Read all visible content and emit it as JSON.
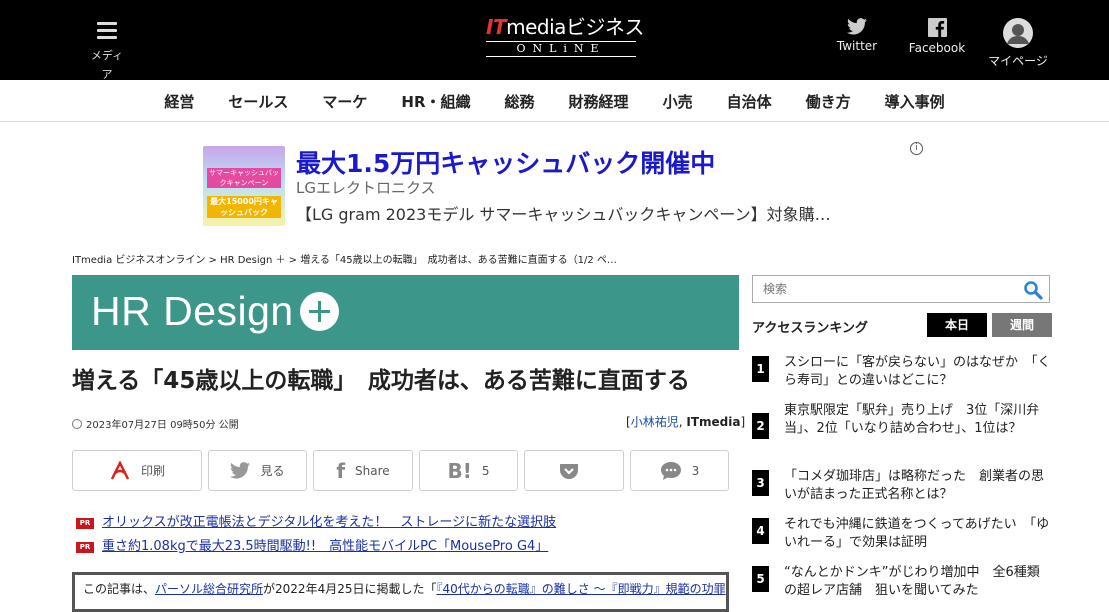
{
  "header": {
    "menu_label": "メディア",
    "logo_part1": "IT",
    "logo_part2": "media",
    "logo_part3": "ビジネス",
    "logo_sub": "ONLiNE",
    "twitter_label": "Twitter",
    "facebook_label": "Facebook",
    "mypage_label": "マイページ"
  },
  "nav": {
    "items": [
      "経営",
      "セールス",
      "マーケ",
      "HR・組織",
      "総務",
      "財務経理",
      "小売",
      "自治体",
      "働き方",
      "導入事例"
    ]
  },
  "ad": {
    "image_text1": "サマーキャッシュバックキャンペーン",
    "image_text2": "最大15000円キャッシュバック",
    "title": "最大1.5万円キャッシュバック開催中",
    "sponsor": "LGエレクトロニクス",
    "description": "【LG gram 2023モデル サマーキャッシュバックキャンペーン】対象購…",
    "info_icon": "i"
  },
  "breadcrumb": "ITmedia ビジネスオンライン > HR Design ＋ > 増える「45歳以上の転職」　成功者は、ある苦難に直面する（1/2 ペ…",
  "banner": {
    "title": "HR Design"
  },
  "article": {
    "headline": "増える「45歳以上の転職」　成功者は、ある苦難に直面する",
    "date": "2023年07月27日 09時50分 公開",
    "author_open": "[",
    "author_name": "小林祐児",
    "author_sep": ",",
    "author_org": "ITmedia",
    "author_close": "]"
  },
  "share": {
    "print_label": "印刷",
    "tweet_label": "見る",
    "facebook_label": "Share",
    "hatena_count": "5",
    "pocket_label": "",
    "comment_count": "3"
  },
  "pr": {
    "tag": "PR",
    "link1": "オリックスが改正電帳法とデジタル化を考えた！　ストレージに新たな選択肢",
    "link2": "重さ約1.08kgで最大23.5時間駆動!!　高性能モバイルPC「MousePro G4」"
  },
  "notice": {
    "prefix": "この記事は、",
    "source": "パーソル総合研究所",
    "middle": "が2022年4月25日に掲載した「",
    "article": "『40代からの転職』の難しさ ～『即戦力』規範の功罪"
  },
  "sidebar": {
    "search_placeholder": "検索",
    "ranking_title": "アクセスランキング",
    "tab_today": "本日",
    "tab_week": "週間",
    "ranking": [
      {
        "rank": "1",
        "title": "スシローに「客が戻らない」のはなぜか　「くら寿司」との違いはどこに？"
      },
      {
        "rank": "2",
        "title": "東京駅限定「駅弁」売り上げ　3位「深川弁当」、2位「いなり詰め合わせ」、1位は？"
      },
      {
        "rank": "3",
        "title": "「コメダ珈琲店」は略称だった　創業者の思いが詰まった正式名称とは？"
      },
      {
        "rank": "4",
        "title": "それでも沖縄に鉄道をつくってあげたい　「ゆいれーる」で効果は証明"
      },
      {
        "rank": "5",
        "title": "“なんとかドンキ”がじわり増加中　全6種類の超レア店舗　狙いを聞いてみた"
      }
    ]
  }
}
